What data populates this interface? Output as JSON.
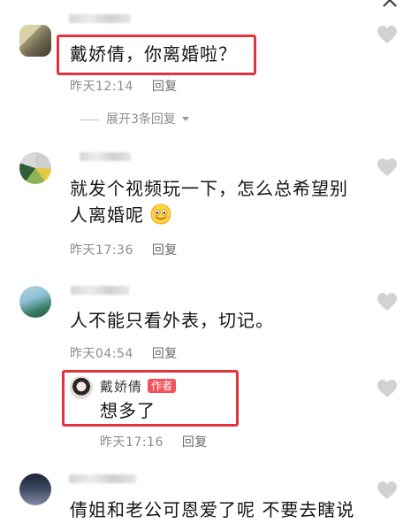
{
  "comments": [
    {
      "text": "戴娇倩，你离婚啦？",
      "time": "昨天12:14",
      "reply_label": "回复",
      "expand_label": "展开3条回复"
    },
    {
      "text_line1": "就发个视频玩一下，怎么总希望别",
      "text_line2": "人离婚呢",
      "time": "昨天17:36",
      "reply_label": "回复"
    },
    {
      "text": "人不能只看外表，切记。",
      "time": "昨天04:54",
      "reply_label": "回复"
    },
    {
      "text": "倩姐和老公可恩爱了呢 不要去瞎说"
    }
  ],
  "author_reply": {
    "name": "戴娇倩",
    "badge": "作者",
    "text": "想多了",
    "time": "昨天17:16",
    "reply_label": "回复"
  },
  "icons": {
    "like": "heart-icon",
    "close": "close-icon",
    "expand": "chevron-down-icon",
    "emoji": "smile-emoji-icon"
  },
  "colors": {
    "highlight": "#e1343e",
    "badge": "#f2535c",
    "meta": "#8c8c8c"
  }
}
